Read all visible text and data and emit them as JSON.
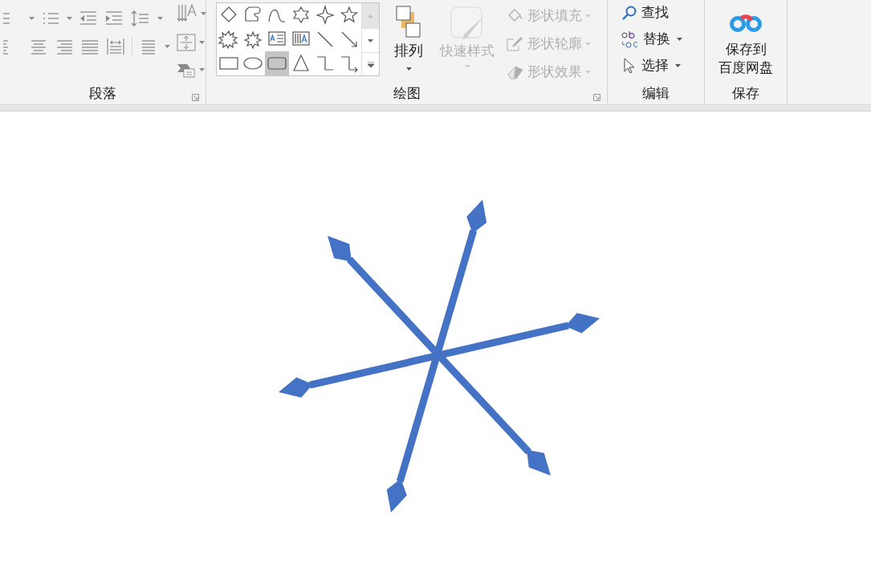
{
  "ribbon": {
    "groups": [
      {
        "kind": "paragraph",
        "label": "段落"
      },
      {
        "kind": "drawing",
        "label": "绘图",
        "shapes": [
          {
            "kind": "diamond",
            "selected": false
          },
          {
            "kind": "snip",
            "selected": false
          },
          {
            "kind": "curve",
            "selected": false
          },
          {
            "kind": "star6",
            "selected": false
          },
          {
            "kind": "star4",
            "selected": false
          },
          {
            "kind": "star5",
            "selected": false
          },
          {
            "kind": "burst1",
            "selected": false
          },
          {
            "kind": "burst2",
            "selected": false
          },
          {
            "kind": "textbox",
            "selected": false
          },
          {
            "kind": "vtextbox",
            "selected": false
          },
          {
            "kind": "line",
            "selected": false
          },
          {
            "kind": "arrow",
            "selected": false
          },
          {
            "kind": "rect",
            "selected": false
          },
          {
            "kind": "oval",
            "selected": false
          },
          {
            "kind": "roundrect",
            "selected": true
          },
          {
            "kind": "triangle",
            "selected": false
          },
          {
            "kind": "elbow",
            "selected": false
          },
          {
            "kind": "elbowarrow",
            "selected": false
          }
        ],
        "arrange": {
          "label": "排列",
          "disabled": false
        },
        "quick_styles": {
          "label": "快速样式",
          "disabled": true
        },
        "format_items": [
          {
            "kind": "fill",
            "label": "形状填充",
            "disabled": true
          },
          {
            "kind": "outline",
            "label": "形状轮廓",
            "disabled": true
          },
          {
            "kind": "effects",
            "label": "形状效果",
            "disabled": true
          }
        ]
      },
      {
        "kind": "editing",
        "label": "编辑",
        "items": [
          {
            "kind": "find",
            "label": "查找",
            "dropdown": false
          },
          {
            "kind": "replace",
            "label": "替换",
            "dropdown": true
          },
          {
            "kind": "select",
            "label": "选择",
            "dropdown": true
          }
        ]
      },
      {
        "kind": "save",
        "label": "保存",
        "button": {
          "line_1": "保存到",
          "line_2": "百度网盘"
        }
      }
    ]
  }
}
